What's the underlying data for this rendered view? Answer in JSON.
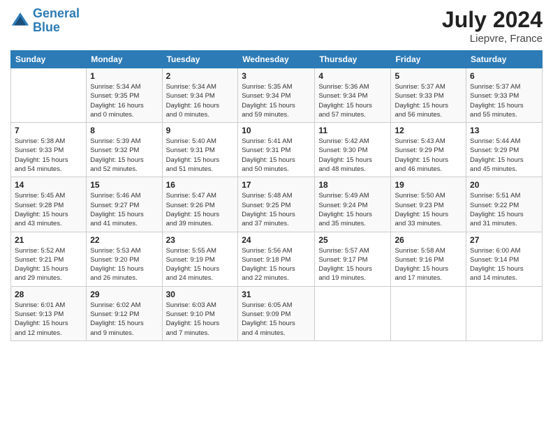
{
  "header": {
    "logo_line1": "General",
    "logo_line2": "Blue",
    "month_year": "July 2024",
    "location": "Liepvre, France"
  },
  "weekdays": [
    "Sunday",
    "Monday",
    "Tuesday",
    "Wednesday",
    "Thursday",
    "Friday",
    "Saturday"
  ],
  "weeks": [
    [
      {
        "day": "",
        "info": ""
      },
      {
        "day": "1",
        "info": "Sunrise: 5:34 AM\nSunset: 9:35 PM\nDaylight: 16 hours\nand 0 minutes."
      },
      {
        "day": "2",
        "info": "Sunrise: 5:34 AM\nSunset: 9:34 PM\nDaylight: 16 hours\nand 0 minutes."
      },
      {
        "day": "3",
        "info": "Sunrise: 5:35 AM\nSunset: 9:34 PM\nDaylight: 15 hours\nand 59 minutes."
      },
      {
        "day": "4",
        "info": "Sunrise: 5:36 AM\nSunset: 9:34 PM\nDaylight: 15 hours\nand 57 minutes."
      },
      {
        "day": "5",
        "info": "Sunrise: 5:37 AM\nSunset: 9:33 PM\nDaylight: 15 hours\nand 56 minutes."
      },
      {
        "day": "6",
        "info": "Sunrise: 5:37 AM\nSunset: 9:33 PM\nDaylight: 15 hours\nand 55 minutes."
      }
    ],
    [
      {
        "day": "7",
        "info": "Sunrise: 5:38 AM\nSunset: 9:33 PM\nDaylight: 15 hours\nand 54 minutes."
      },
      {
        "day": "8",
        "info": "Sunrise: 5:39 AM\nSunset: 9:32 PM\nDaylight: 15 hours\nand 52 minutes."
      },
      {
        "day": "9",
        "info": "Sunrise: 5:40 AM\nSunset: 9:31 PM\nDaylight: 15 hours\nand 51 minutes."
      },
      {
        "day": "10",
        "info": "Sunrise: 5:41 AM\nSunset: 9:31 PM\nDaylight: 15 hours\nand 50 minutes."
      },
      {
        "day": "11",
        "info": "Sunrise: 5:42 AM\nSunset: 9:30 PM\nDaylight: 15 hours\nand 48 minutes."
      },
      {
        "day": "12",
        "info": "Sunrise: 5:43 AM\nSunset: 9:29 PM\nDaylight: 15 hours\nand 46 minutes."
      },
      {
        "day": "13",
        "info": "Sunrise: 5:44 AM\nSunset: 9:29 PM\nDaylight: 15 hours\nand 45 minutes."
      }
    ],
    [
      {
        "day": "14",
        "info": "Sunrise: 5:45 AM\nSunset: 9:28 PM\nDaylight: 15 hours\nand 43 minutes."
      },
      {
        "day": "15",
        "info": "Sunrise: 5:46 AM\nSunset: 9:27 PM\nDaylight: 15 hours\nand 41 minutes."
      },
      {
        "day": "16",
        "info": "Sunrise: 5:47 AM\nSunset: 9:26 PM\nDaylight: 15 hours\nand 39 minutes."
      },
      {
        "day": "17",
        "info": "Sunrise: 5:48 AM\nSunset: 9:25 PM\nDaylight: 15 hours\nand 37 minutes."
      },
      {
        "day": "18",
        "info": "Sunrise: 5:49 AM\nSunset: 9:24 PM\nDaylight: 15 hours\nand 35 minutes."
      },
      {
        "day": "19",
        "info": "Sunrise: 5:50 AM\nSunset: 9:23 PM\nDaylight: 15 hours\nand 33 minutes."
      },
      {
        "day": "20",
        "info": "Sunrise: 5:51 AM\nSunset: 9:22 PM\nDaylight: 15 hours\nand 31 minutes."
      }
    ],
    [
      {
        "day": "21",
        "info": "Sunrise: 5:52 AM\nSunset: 9:21 PM\nDaylight: 15 hours\nand 29 minutes."
      },
      {
        "day": "22",
        "info": "Sunrise: 5:53 AM\nSunset: 9:20 PM\nDaylight: 15 hours\nand 26 minutes."
      },
      {
        "day": "23",
        "info": "Sunrise: 5:55 AM\nSunset: 9:19 PM\nDaylight: 15 hours\nand 24 minutes."
      },
      {
        "day": "24",
        "info": "Sunrise: 5:56 AM\nSunset: 9:18 PM\nDaylight: 15 hours\nand 22 minutes."
      },
      {
        "day": "25",
        "info": "Sunrise: 5:57 AM\nSunset: 9:17 PM\nDaylight: 15 hours\nand 19 minutes."
      },
      {
        "day": "26",
        "info": "Sunrise: 5:58 AM\nSunset: 9:16 PM\nDaylight: 15 hours\nand 17 minutes."
      },
      {
        "day": "27",
        "info": "Sunrise: 6:00 AM\nSunset: 9:14 PM\nDaylight: 15 hours\nand 14 minutes."
      }
    ],
    [
      {
        "day": "28",
        "info": "Sunrise: 6:01 AM\nSunset: 9:13 PM\nDaylight: 15 hours\nand 12 minutes."
      },
      {
        "day": "29",
        "info": "Sunrise: 6:02 AM\nSunset: 9:12 PM\nDaylight: 15 hours\nand 9 minutes."
      },
      {
        "day": "30",
        "info": "Sunrise: 6:03 AM\nSunset: 9:10 PM\nDaylight: 15 hours\nand 7 minutes."
      },
      {
        "day": "31",
        "info": "Sunrise: 6:05 AM\nSunset: 9:09 PM\nDaylight: 15 hours\nand 4 minutes."
      },
      {
        "day": "",
        "info": ""
      },
      {
        "day": "",
        "info": ""
      },
      {
        "day": "",
        "info": ""
      }
    ]
  ]
}
